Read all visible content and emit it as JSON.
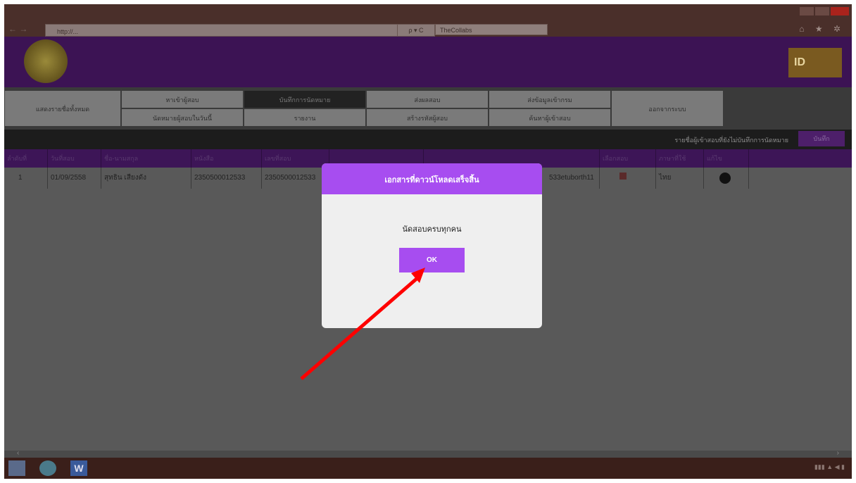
{
  "browser": {
    "address_url": "http://...",
    "tab_title": "TheCollabs",
    "nav_symbols": "← →",
    "address_controls": "ρ ▾ C",
    "toolbar_icons": "⌂ ★ ✲"
  },
  "brand": {
    "right_logo_text": "ID"
  },
  "menu": {
    "row1": [
      "แสดงรายชื่อทั้งหมด",
      "หาเข้าผู้สอบ",
      "บันทึกการนัดหมาย",
      "ส่งผลสอบ",
      "ส่งข้อมูลเข้ากรม",
      "ออกจากระบบ"
    ],
    "row2": [
      "นัดหมายผู้สอบในวันนี้",
      "รายงาน",
      "สร้างรหัสผู้สอบ",
      "ค้นหาผู้เข้าสอบ"
    ]
  },
  "subbar": {
    "text": "รายชื่อผู้เข้าสอบที่ยังไม่บันทึกการนัดหมาย",
    "button": "บันทึก"
  },
  "table": {
    "headers": [
      "ลำดับที่",
      "วันที่สอบ",
      "ชื่อ-นามสกุล",
      "หนังสือ",
      "เลขที่สอบ",
      "",
      "",
      "เลือกสอบ",
      "ภาษาที่ใช้",
      "แก้ไข"
    ],
    "row": {
      "no": "1",
      "date": "01/09/2558",
      "name": "สุทธิน เสียงดัง",
      "book": "2350500012533",
      "exam_no": "2350500012533",
      "user": "533etuborth11",
      "language": "ไทย"
    }
  },
  "dialog": {
    "title": "เอกสารที่ดาวน์โหลดเสร็จสิ้น",
    "message": "นัดสอบครบทุกคน",
    "ok_label": "OK"
  },
  "taskbar": {
    "word_icon_text": "W"
  },
  "colors": {
    "dialog_accent": "#a74df0",
    "arrow": "#ff0000"
  }
}
